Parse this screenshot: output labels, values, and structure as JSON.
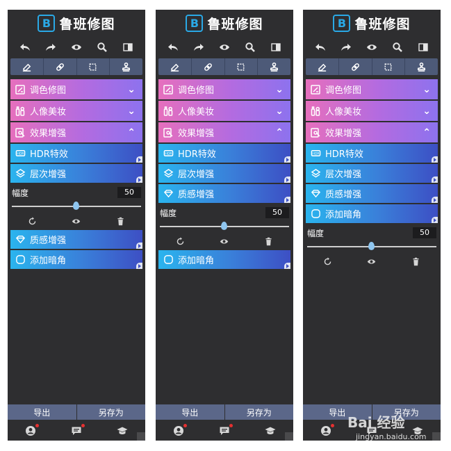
{
  "app": {
    "logo_badge": "B",
    "logo_text": "鲁班修图"
  },
  "colors": {
    "panel_bg": "#2e2e30",
    "accent_blue": "#2aa9e6",
    "category_gradient": "#e66fbd",
    "subitem_gradient": "#2ab4ee"
  },
  "toolbar": {
    "icons": [
      "undo-icon",
      "redo-icon",
      "eye-icon",
      "zoom-icon",
      "compare-icon"
    ]
  },
  "modes": {
    "icons": [
      "eraser-icon",
      "bandage-icon",
      "crop-icon",
      "stamp-icon"
    ]
  },
  "categories": {
    "color": "调色修图",
    "portrait": "人像美妆",
    "effects": "效果增强"
  },
  "sub": {
    "hdr": "HDR特效",
    "layer": "层次增强",
    "texture": "质感增强",
    "vignette": "添加暗角"
  },
  "adjust": {
    "label": "幅度",
    "value": "50",
    "level_percent": 50
  },
  "footer": {
    "export": "导出",
    "save_as": "另存为"
  },
  "watermark": {
    "brand": "Bai 经验",
    "url": "jingyan.baidu.com"
  }
}
